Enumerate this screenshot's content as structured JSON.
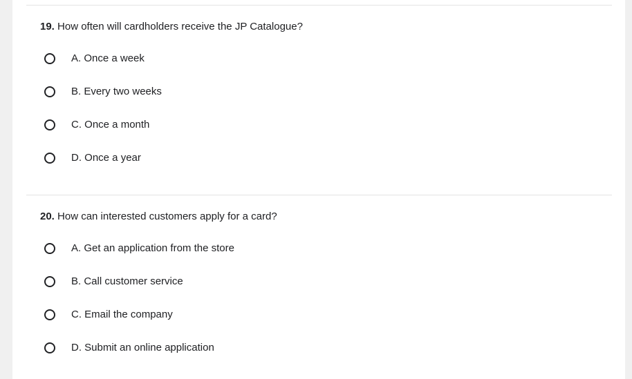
{
  "questions": [
    {
      "number": "19.",
      "text": "How often will cardholders receive the JP Catalogue?",
      "options": [
        "A. Once a week",
        "B. Every two weeks",
        "C. Once a month",
        "D. Once a year"
      ]
    },
    {
      "number": "20.",
      "text": "How can interested customers apply for a card?",
      "options": [
        "A. Get an application from the store",
        "B. Call customer service",
        "C. Email the company",
        "D. Submit an online application"
      ]
    }
  ]
}
